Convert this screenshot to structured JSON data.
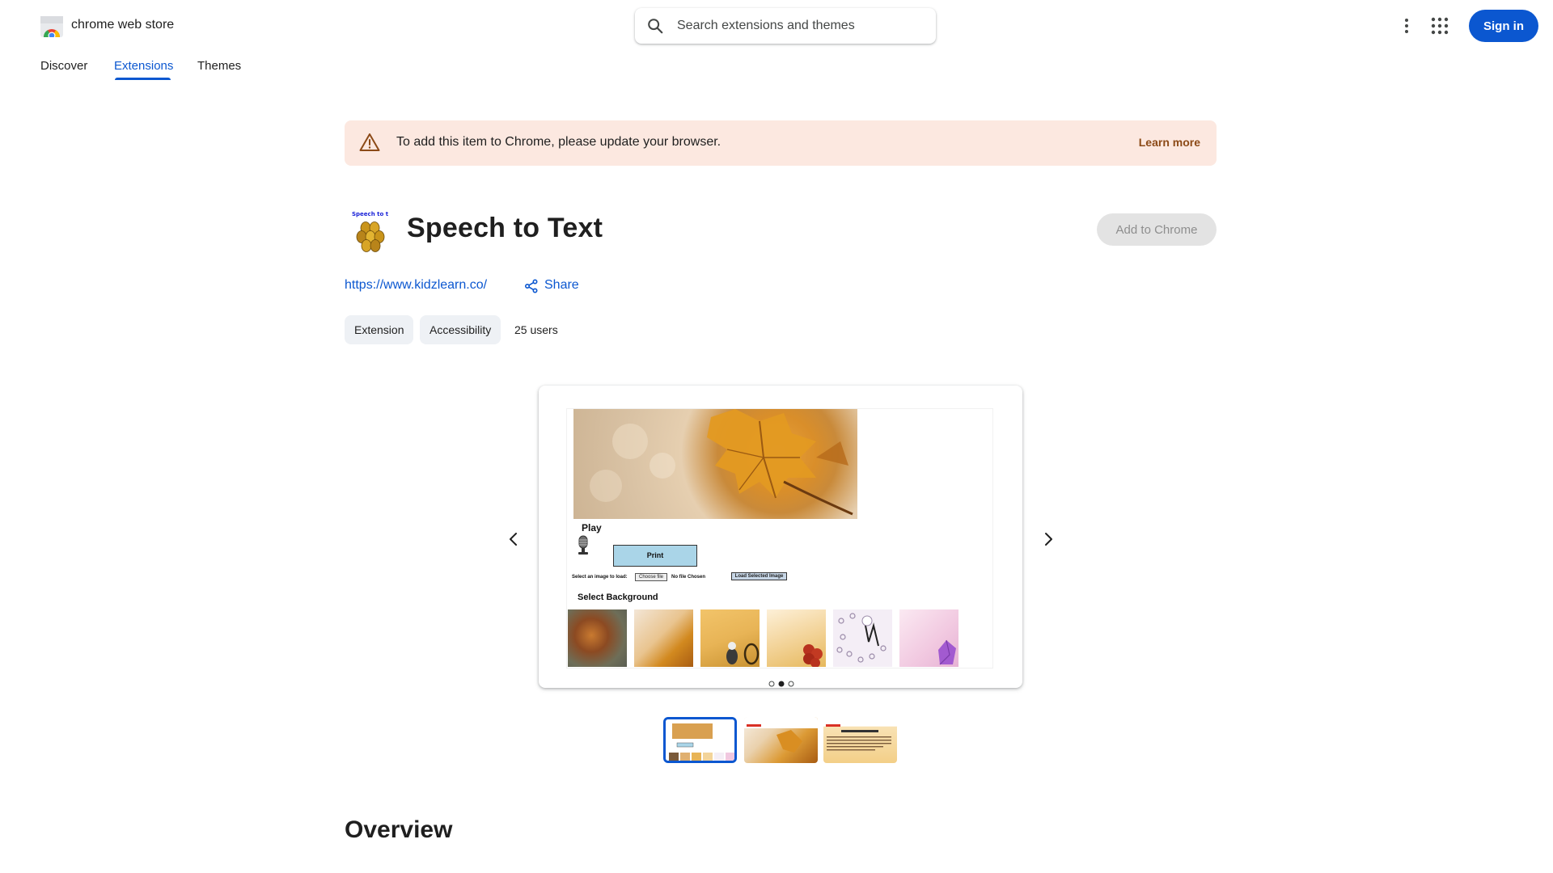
{
  "header": {
    "brand": "chrome web store",
    "search_placeholder": "Search extensions and themes",
    "sign_in": "Sign in"
  },
  "nav": {
    "tabs": [
      {
        "label": "Discover",
        "active": false
      },
      {
        "label": "Extensions",
        "active": true
      },
      {
        "label": "Themes",
        "active": false
      }
    ]
  },
  "banner": {
    "message": "To add this item to Chrome, please update your browser.",
    "learn_more": "Learn more"
  },
  "item": {
    "icon_caption": "Speech to text",
    "title": "Speech to Text",
    "add_button": "Add to Chrome",
    "website": "https://www.kidzlearn.co/",
    "share": "Share",
    "chips": [
      "Extension",
      "Accessibility"
    ],
    "users": "25 users"
  },
  "screenshot": {
    "play_label": "Play",
    "print_label": "Print",
    "select_image_label": "Select an image to load:",
    "choose_file": "Choose file",
    "no_file": "No file Chosen",
    "load_selected": "Load Selected Image",
    "select_background": "Select Background"
  },
  "carousel": {
    "slide_count": 3,
    "active_slide": 2
  },
  "sections": {
    "overview": "Overview"
  },
  "colors": {
    "accent": "#0b57d0",
    "banner_bg": "#fce8e0",
    "learn_more": "#8c4a17"
  }
}
